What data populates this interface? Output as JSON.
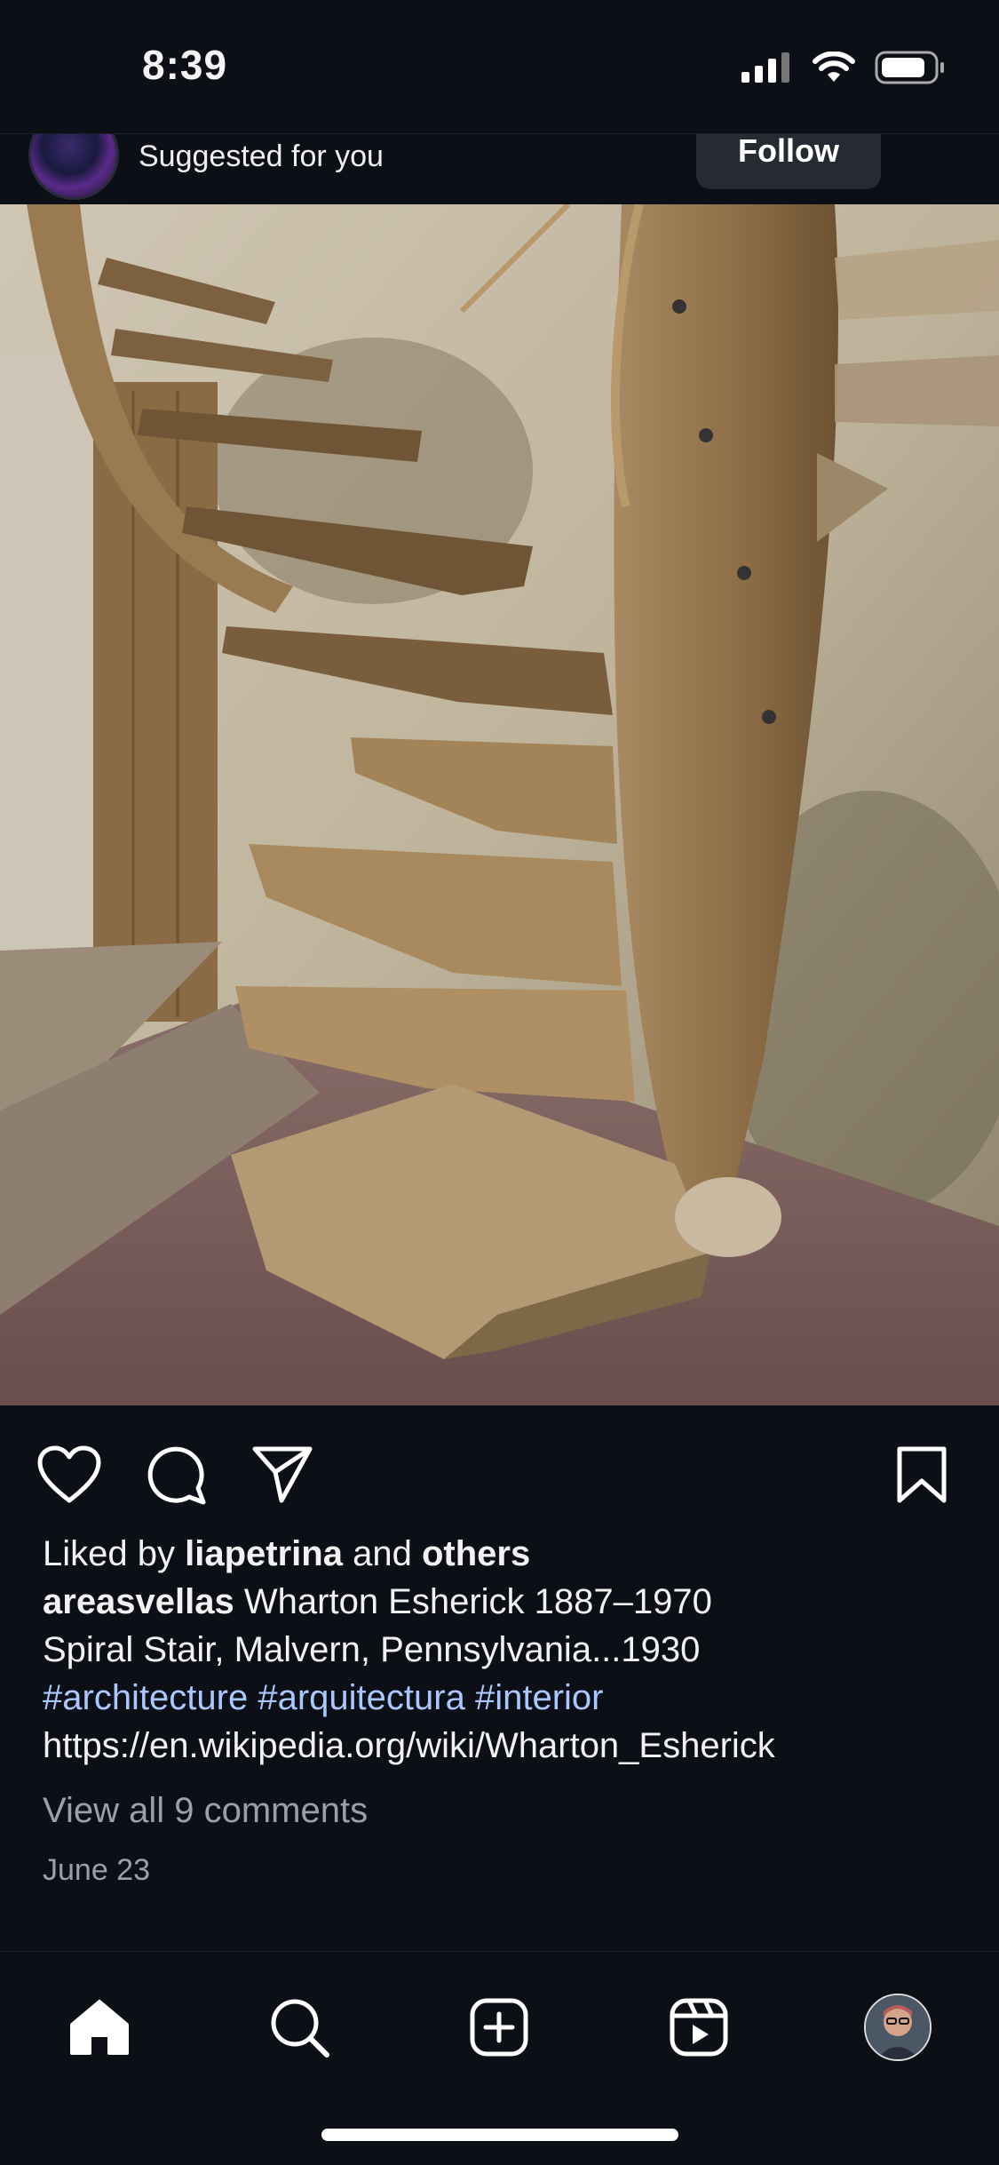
{
  "status": {
    "time": "8:39"
  },
  "header": {
    "suggested": "Suggested for you",
    "follow": "Follow"
  },
  "post": {
    "image_alt": "Wooden spiral staircase",
    "liked_prefix": "Liked by",
    "liked_user": "liapetrina",
    "liked_and": "and",
    "liked_others": "others"
  },
  "caption": {
    "username": "areasvellas",
    "line1": "Wharton Esherick 1887–1970",
    "line2": "Spiral Stair, Malvern, Pennsylvania...1930",
    "hashtags": [
      "#architecture",
      "#arquitectura",
      "#interior"
    ],
    "link": "https://en.wikipedia.org/wiki/Wharton_Esherick"
  },
  "comments": {
    "view_all": "View all 9 comments"
  },
  "date": "June 23",
  "tabs": [
    "home",
    "search",
    "create",
    "reels",
    "profile"
  ]
}
